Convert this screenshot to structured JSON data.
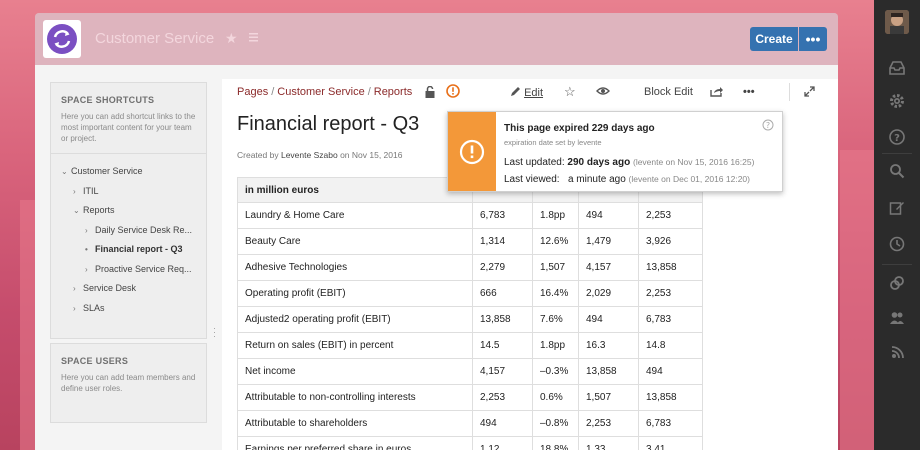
{
  "header": {
    "space_title": "Customer Service",
    "create_label": "Create",
    "more_label": "•••"
  },
  "sidebar": {
    "shortcuts_heading": "SPACE SHORTCUTS",
    "shortcuts_text": "Here you can add shortcut links to the most important content for your team or project.",
    "tree": [
      {
        "label": "Customer Service",
        "toggle": "⌄"
      },
      {
        "label": "ITIL",
        "toggle": "›"
      },
      {
        "label": "Reports",
        "toggle": "⌄"
      },
      {
        "label": "Daily Service Desk Re...",
        "toggle": "›"
      },
      {
        "label": "Financial report - Q3",
        "toggle": "•"
      },
      {
        "label": "Proactive Service Req...",
        "toggle": "›"
      },
      {
        "label": "Service Desk",
        "toggle": "›"
      },
      {
        "label": "SLAs",
        "toggle": "›"
      }
    ],
    "users_heading": "SPACE USERS",
    "users_text": "Here you can add team members and define user roles."
  },
  "breadcrumb": {
    "items": [
      "Pages",
      "Customer Service",
      "Reports"
    ]
  },
  "toolbar": {
    "edit_label": "Edit",
    "block_edit_label": "Block Edit",
    "more_label": "•••"
  },
  "page": {
    "title": "Financial report - Q3",
    "created_by_prefix": "Created by",
    "author": "Levente Szabo",
    "on_text": "on",
    "created_date": "Nov 15, 2016"
  },
  "table": {
    "header": [
      "in million euros",
      "",
      "",
      "",
      ""
    ],
    "rows": [
      [
        "Laundry & Home Care",
        "6,783",
        "1.8pp",
        "494",
        "2,253"
      ],
      [
        "Beauty Care",
        "1,314",
        "12.6%",
        "1,479",
        "3,926"
      ],
      [
        "Adhesive Technologies",
        "2,279",
        "1,507",
        "4,157",
        "13,858"
      ],
      [
        "Operating profit (EBIT)",
        "666",
        "16.4%",
        "2,029",
        "2,253"
      ],
      [
        "Adjusted2 operating profit (EBIT)",
        "13,858",
        "7.6%",
        "494",
        "6,783"
      ],
      [
        "Return on sales (EBIT) in percent",
        "14.5",
        "1.8pp",
        "16.3",
        "14.8"
      ],
      [
        "Net income",
        "4,157",
        "–0.3%",
        "13,858",
        "494"
      ],
      [
        "Attributable to non-controlling interests",
        "2,253",
        "0.6%",
        "1,507",
        "13,858"
      ],
      [
        "Attributable to shareholders",
        "494",
        "–0.8%",
        "2,253",
        "6,783"
      ],
      [
        "Earnings per preferred share in euros",
        "1.12",
        "18.8%",
        "1.33",
        "3.41"
      ]
    ]
  },
  "popup": {
    "title": "This page expired 229 days ago",
    "subtitle": "expiration date set by levente",
    "updated_label": "Last updated:",
    "updated_value": "290 days ago",
    "updated_detail": "(levente on Nov 15, 2016 16:25)",
    "viewed_label": "Last viewed:",
    "viewed_value": "a minute ago",
    "viewed_detail": "(levente on Dec 01, 2016 12:20)"
  },
  "colors": {
    "accent": "#3572b0",
    "warning": "#f39839",
    "link": "#8b2a2a"
  }
}
